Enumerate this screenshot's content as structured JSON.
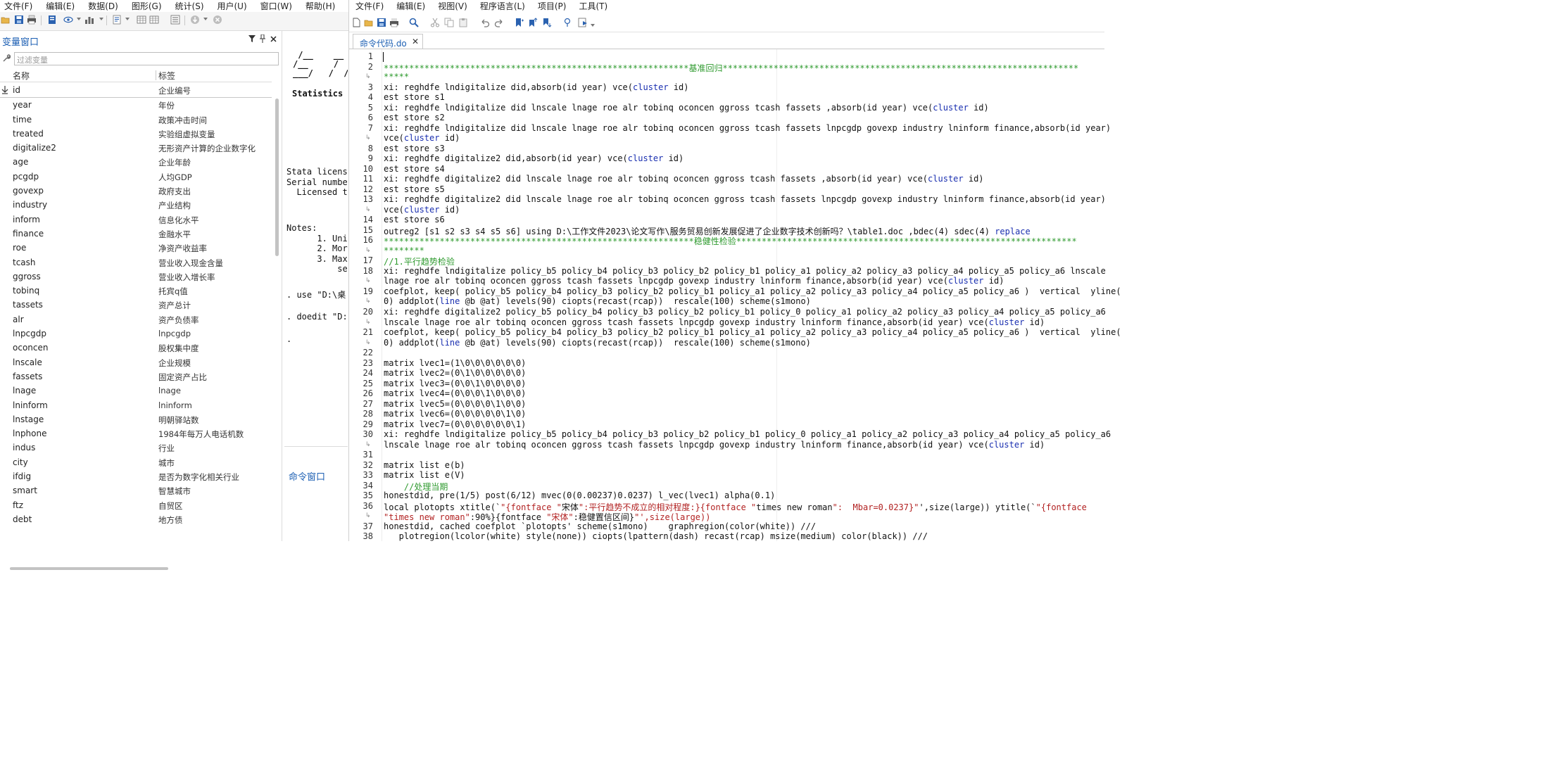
{
  "stata": {
    "menu": [
      "文件(F)",
      "编辑(E)",
      "数据(D)",
      "图形(G)",
      "统计(S)",
      "用户(U)",
      "窗口(W)",
      "帮助(H)"
    ],
    "variables_window": {
      "title": "变量窗口",
      "filter_placeholder": "过滤变量",
      "col_name": "名称",
      "col_label": "标签",
      "rows": [
        {
          "name": "id",
          "label": "企业编号"
        },
        {
          "name": "year",
          "label": "年份"
        },
        {
          "name": "time",
          "label": "政策冲击时间"
        },
        {
          "name": "treated",
          "label": "实验组虚拟变量"
        },
        {
          "name": "digitalize2",
          "label": "无形资产计算的企业数字化"
        },
        {
          "name": "age",
          "label": "企业年龄"
        },
        {
          "name": "pcgdp",
          "label": "人均GDP"
        },
        {
          "name": "govexp",
          "label": "政府支出"
        },
        {
          "name": "industry",
          "label": "产业结构"
        },
        {
          "name": "inform",
          "label": "信息化水平"
        },
        {
          "name": "finance",
          "label": "金融水平"
        },
        {
          "name": "roe",
          "label": "净资产收益率"
        },
        {
          "name": "tcash",
          "label": "营业收入现金含量"
        },
        {
          "name": "ggross",
          "label": "营业收入增长率"
        },
        {
          "name": "tobinq",
          "label": "托宾q值"
        },
        {
          "name": "tassets",
          "label": "资产总计"
        },
        {
          "name": "alr",
          "label": "资产负债率"
        },
        {
          "name": "lnpcgdp",
          "label": "lnpcgdp"
        },
        {
          "name": "oconcen",
          "label": "股权集中度"
        },
        {
          "name": "lnscale",
          "label": "企业规模"
        },
        {
          "name": "fassets",
          "label": "固定资产占比"
        },
        {
          "name": "lnage",
          "label": "lnage"
        },
        {
          "name": "lninform",
          "label": "lninform"
        },
        {
          "name": "lnstage",
          "label": "明朝驿站数"
        },
        {
          "name": "lnphone",
          "label": "1984年每万人电话机数"
        },
        {
          "name": "indus",
          "label": "行业"
        },
        {
          "name": "city",
          "label": "城市"
        },
        {
          "name": "ifdig",
          "label": "是否为数字化相关行业"
        },
        {
          "name": "smart",
          "label": "智慧城市"
        },
        {
          "name": "ftz",
          "label": "自贸区"
        },
        {
          "name": "debt",
          "label": "地方债"
        }
      ]
    },
    "results_window": {
      "logo": " /__    __  /\n/__     /  /\n___/   /  /",
      "stats_line": "Statistics",
      "license_lines": "Stata licens\nSerial number\n  Licensed t",
      "notes": "Notes:\n      1. Uni\n      2. Mor\n      3. Max\n          se",
      "use_line": ". use \"D:\\桌",
      "doedit_line": ". doedit \"D:",
      "prompt": "."
    },
    "command_window_title": "命令窗口"
  },
  "editor": {
    "menu": [
      "文件(F)",
      "编辑(E)",
      "视图(V)",
      "程序语言(L)",
      "项目(P)",
      "工具(T)"
    ],
    "tab_label": "命令代码.do",
    "tab_close": "✕",
    "lines": [
      {
        "n": "1",
        "t": ""
      },
      {
        "n": "2",
        "t": "************************************************************基准回归**********************************************************************",
        "c": "green"
      },
      {
        "n": "",
        "t": "*****",
        "c": "green",
        "fold": true
      },
      {
        "n": "3",
        "t": "xi: reghdfe lndigitalize did,absorb(id year) vce(cluster id)"
      },
      {
        "n": "4",
        "t": "est store s1"
      },
      {
        "n": "5",
        "t": "xi: reghdfe lndigitalize did lnscale lnage roe alr tobinq oconcen ggross tcash fassets ,absorb(id year) vce(cluster id)"
      },
      {
        "n": "6",
        "t": "est store s2"
      },
      {
        "n": "7",
        "t": "xi: reghdfe lndigitalize did lnscale lnage roe alr tobinq oconcen ggross tcash fassets lnpcgdp govexp industry lninform finance,absorb(id year)"
      },
      {
        "n": "",
        "t": "vce(cluster id)",
        "fold": true
      },
      {
        "n": "8",
        "t": "est store s3"
      },
      {
        "n": "9",
        "t": "xi: reghdfe digitalize2 did,absorb(id year) vce(cluster id)"
      },
      {
        "n": "10",
        "t": "est store s4"
      },
      {
        "n": "11",
        "t": "xi: reghdfe digitalize2 did lnscale lnage roe alr tobinq oconcen ggross tcash fassets ,absorb(id year) vce(cluster id)"
      },
      {
        "n": "12",
        "t": "est store s5"
      },
      {
        "n": "13",
        "t": "xi: reghdfe digitalize2 did lnscale lnage roe alr tobinq oconcen ggross tcash fassets lnpcgdp govexp industry lninform finance,absorb(id year)"
      },
      {
        "n": "",
        "t": "vce(cluster id)",
        "fold": true
      },
      {
        "n": "14",
        "t": "est store s6"
      },
      {
        "n": "15",
        "t": "outreg2 [s1 s2 s3 s4 s5 s6] using D:\\工作文件2023\\论文写作\\服务贸易创新发展促进了企业数字技术创新吗？\\table1.doc ,bdec(4) sdec(4) replace"
      },
      {
        "n": "16",
        "t": "*************************************************************稳健性检验*******************************************************************",
        "c": "green"
      },
      {
        "n": "",
        "t": "********",
        "c": "green",
        "fold": true
      },
      {
        "n": "17",
        "t": "//1.平行趋势检验",
        "c": "green"
      },
      {
        "n": "18",
        "t": "xi: reghdfe lndigitalize policy_b5 policy_b4 policy_b3 policy_b2 policy_b1 policy_a1 policy_a2 policy_a3 policy_a4 policy_a5 policy_a6 lnscale"
      },
      {
        "n": "",
        "t": "lnage roe alr tobinq oconcen ggross tcash fassets lnpcgdp govexp industry lninform finance,absorb(id year) vce(cluster id)",
        "fold": true
      },
      {
        "n": "19",
        "t": "coefplot, keep( policy_b5 policy_b4 policy_b3 policy_b2 policy_b1 policy_a1 policy_a2 policy_a3 policy_a4 policy_a5 policy_a6 )  vertical  yline("
      },
      {
        "n": "",
        "t": "0) addplot(line @b @at) levels(90) ciopts(recast(rcap))  rescale(100) scheme(s1mono)",
        "fold": true
      },
      {
        "n": "20",
        "t": "xi: reghdfe digitalize2 policy_b5 policy_b4 policy_b3 policy_b2 policy_b1 policy_0 policy_a1 policy_a2 policy_a3 policy_a4 policy_a5 policy_a6"
      },
      {
        "n": "",
        "t": "lnscale lnage roe alr tobinq oconcen ggross tcash fassets lnpcgdp govexp industry lninform finance,absorb(id year) vce(cluster id)",
        "fold": true
      },
      {
        "n": "21",
        "t": "coefplot, keep( policy_b5 policy_b4 policy_b3 policy_b2 policy_b1 policy_a1 policy_a2 policy_a3 policy_a4 policy_a5 policy_a6 )  vertical  yline("
      },
      {
        "n": "",
        "t": "0) addplot(line @b @at) levels(90) ciopts(recast(rcap))  rescale(100) scheme(s1mono)",
        "fold": true
      },
      {
        "n": "22",
        "t": ""
      },
      {
        "n": "23",
        "t": "matrix lvec1=(1\\0\\0\\0\\0\\0\\0)"
      },
      {
        "n": "24",
        "t": "matrix lvec2=(0\\1\\0\\0\\0\\0\\0)"
      },
      {
        "n": "25",
        "t": "matrix lvec3=(0\\0\\1\\0\\0\\0\\0)"
      },
      {
        "n": "26",
        "t": "matrix lvec4=(0\\0\\0\\1\\0\\0\\0)"
      },
      {
        "n": "27",
        "t": "matrix lvec5=(0\\0\\0\\0\\1\\0\\0)"
      },
      {
        "n": "28",
        "t": "matrix lvec6=(0\\0\\0\\0\\0\\1\\0)"
      },
      {
        "n": "29",
        "t": "matrix lvec7=(0\\0\\0\\0\\0\\0\\1)"
      },
      {
        "n": "30",
        "t": "xi: reghdfe lndigitalize policy_b5 policy_b4 policy_b3 policy_b2 policy_b1 policy_0 policy_a1 policy_a2 policy_a3 policy_a4 policy_a5 policy_a6"
      },
      {
        "n": "",
        "t": "lnscale lnage roe alr tobinq oconcen ggross tcash fassets lnpcgdp govexp industry lninform finance,absorb(id year) vce(cluster id)",
        "fold": true
      },
      {
        "n": "31",
        "t": ""
      },
      {
        "n": "32",
        "t": "matrix list e(b)"
      },
      {
        "n": "33",
        "t": "matrix list e(V)"
      },
      {
        "n": "34",
        "t": "    //处理当期",
        "c": "green"
      },
      {
        "n": "35",
        "t": "honestdid, pre(1/5) post(6/12) mvec(0(0.00237)0.0237) l_vec(lvec1) alpha(0.1)"
      },
      {
        "n": "36",
        "t": "local plotopts xtitle(`\"{fontface \"宋体\":平行趋势不成立的相对程度:}{fontface \"times new roman\":  Mbar=0.0237}\"',size(large)) ytitle(`\"{fontface",
        "c": "mixed"
      },
      {
        "n": "",
        "t": "\"times new roman\":90%}{fontface \"宋体\":稳健置信区间}\"',size(large))",
        "fold": true,
        "c": "mixed"
      },
      {
        "n": "37",
        "t": "honestdid, cached coefplot `plotopts' scheme(s1mono)    graphregion(color(white)) ///"
      },
      {
        "n": "38",
        "t": "   plotregion(lcolor(white) style(none)) ciopts(lpattern(dash) recast(rcap) msize(medium) color(black)) ///"
      }
    ]
  }
}
